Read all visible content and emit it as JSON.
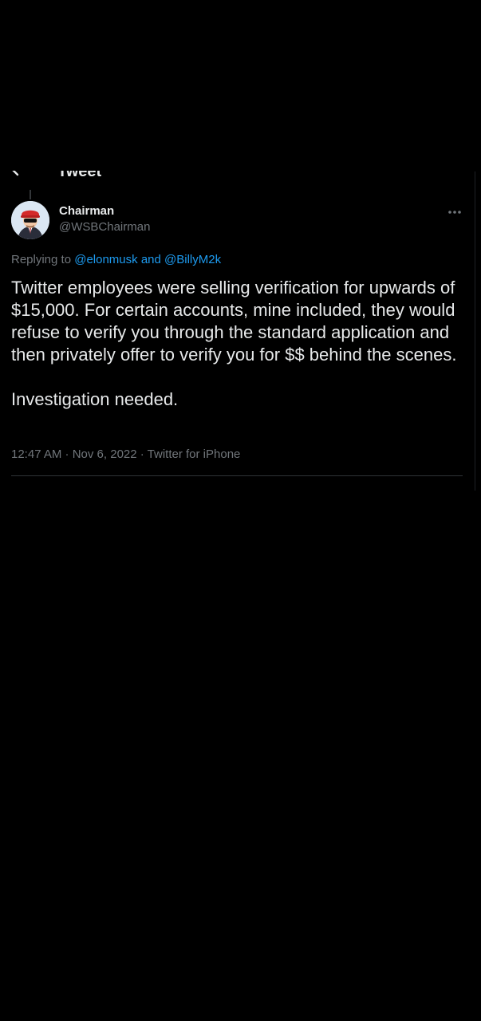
{
  "header": {
    "title": "Tweet",
    "back_icon": "back-arrow-icon"
  },
  "tweet": {
    "author": {
      "display_name": "Chairman",
      "handle": "@WSBChairman",
      "avatar": "avatar-wsb-chairman"
    },
    "reply": {
      "prefix": "Replying to ",
      "mention_1": "@elonmusk",
      "joiner": " and ",
      "mention_2": "@BillyM2k"
    },
    "paragraphs": [
      "Twitter employees were selling verification for upwards of $15,000. For certain accounts, mine included, they would refuse to verify you through the standard application and then privately offer to verify you for $$ behind the scenes.",
      "Investigation needed."
    ],
    "meta": "12:47 AM · Nov 6, 2022 · Twitter for iPhone",
    "more_icon": "more-options-icon"
  },
  "colors": {
    "background": "#000000",
    "text": "#e7e9ea",
    "secondary": "#71767b",
    "link": "#1d9bf0",
    "divider": "#2f3336"
  }
}
